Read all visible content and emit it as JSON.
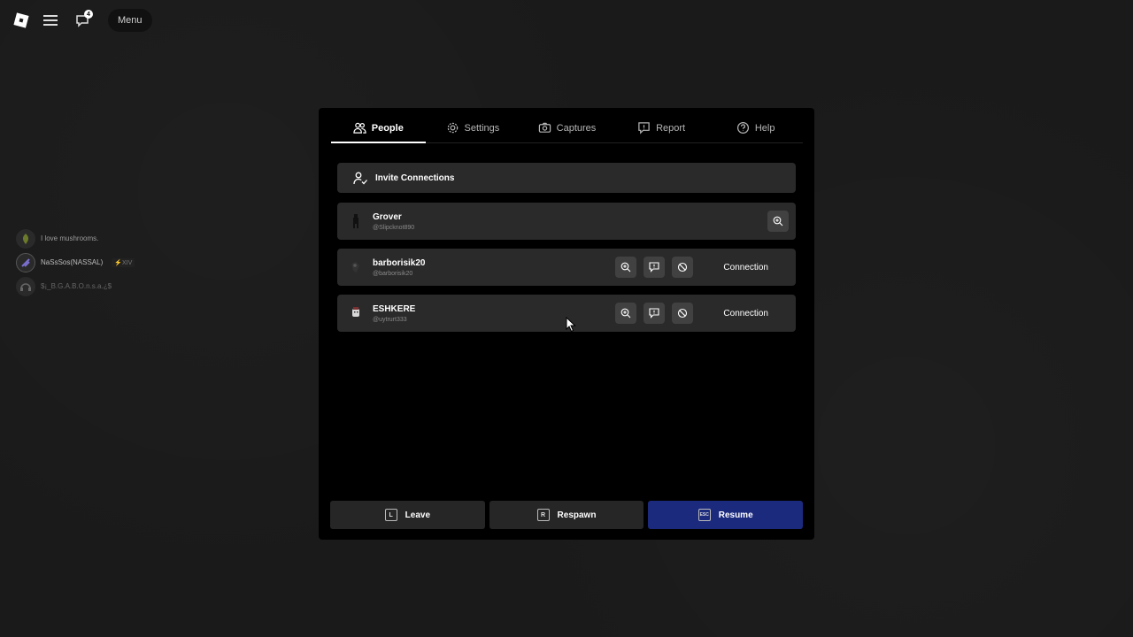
{
  "topbar": {
    "menu_label": "Menu",
    "notification_count": "4"
  },
  "side": {
    "items": [
      {
        "text": "I love mushrooms.",
        "tag": ""
      },
      {
        "text": "NaSsSos(NASSAL)",
        "tag": "⚡XIV"
      },
      {
        "text": "$¡_B.G.A.B.O.n.s.a.¿$",
        "tag": ""
      }
    ]
  },
  "tabs": [
    {
      "label": "People",
      "icon": "people-icon",
      "active": true
    },
    {
      "label": "Settings",
      "icon": "gear-icon",
      "active": false
    },
    {
      "label": "Captures",
      "icon": "camera-icon",
      "active": false
    },
    {
      "label": "Report",
      "icon": "report-icon",
      "active": false
    },
    {
      "label": "Help",
      "icon": "help-icon",
      "active": false
    }
  ],
  "invite": {
    "label": "Invite Connections"
  },
  "players": [
    {
      "name": "Grover",
      "handle": "@Slipcknot890",
      "connection": ""
    },
    {
      "name": "barborisik20",
      "handle": "@barborisik20",
      "connection": "Connection"
    },
    {
      "name": "ESHKERE",
      "handle": "@uytrurt333",
      "connection": "Connection"
    }
  ],
  "bottom": {
    "leave": {
      "key": "L",
      "label": "Leave"
    },
    "respawn": {
      "key": "R",
      "label": "Respawn"
    },
    "resume": {
      "key": "ESC",
      "label": "Resume"
    }
  },
  "colors": {
    "primary_button": "#1c2a7e",
    "row_bg": "#2a2a2a",
    "panel_bg": "#000000"
  }
}
